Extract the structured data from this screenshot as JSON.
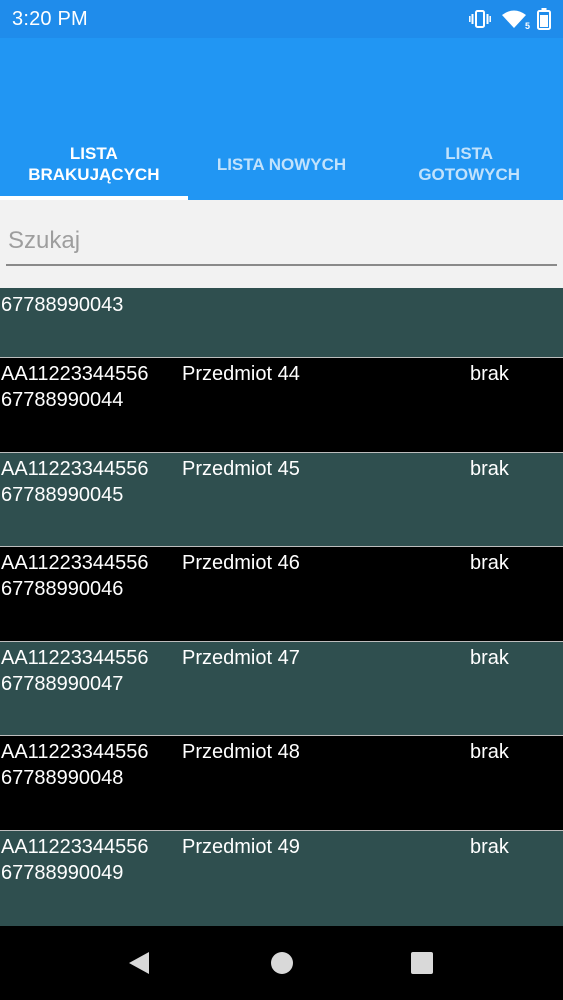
{
  "status_bar": {
    "time": "3:20 PM",
    "icons": [
      "vibrate-icon",
      "wifi-icon",
      "battery-icon"
    ],
    "wifi_label": "5"
  },
  "tabs": [
    {
      "label": "LISTA\nBRAKUJĄCYCH",
      "active": true
    },
    {
      "label": "LISTA NOWYCH",
      "active": false
    },
    {
      "label": "LISTA\nGOTOWYCH",
      "active": false
    }
  ],
  "search": {
    "placeholder": "Szukaj",
    "value": ""
  },
  "list": {
    "first_partial": {
      "ean": "67788990043"
    },
    "items": [
      {
        "code": "AA11223344556",
        "name": "Przedmiot 44",
        "status": "brak",
        "ean": "67788990044"
      },
      {
        "code": "AA11223344556",
        "name": "Przedmiot 45",
        "status": "brak",
        "ean": "67788990045"
      },
      {
        "code": "AA11223344556",
        "name": "Przedmiot 46",
        "status": "brak",
        "ean": "67788990046"
      },
      {
        "code": "AA11223344556",
        "name": "Przedmiot 47",
        "status": "brak",
        "ean": "67788990047"
      },
      {
        "code": "AA11223344556",
        "name": "Przedmiot 48",
        "status": "brak",
        "ean": "67788990048"
      },
      {
        "code": "AA11223344556",
        "name": "Przedmiot 49",
        "status": "brak",
        "ean": "67788990049"
      }
    ]
  },
  "nav_bar": {
    "buttons": [
      "back-icon",
      "home-icon",
      "recents-icon"
    ]
  },
  "colors": {
    "status_bar": "#1f8ceb",
    "app_bar": "#2196f3",
    "row_alt": "#2f4f4f",
    "row_dark": "#000000"
  }
}
